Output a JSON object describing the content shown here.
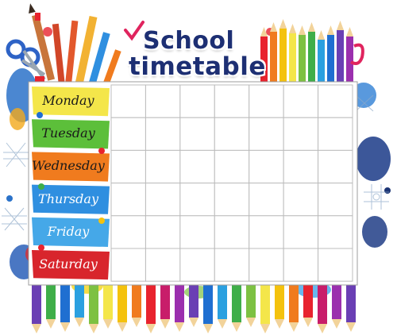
{
  "title": {
    "line1": "School",
    "line2": "timetable"
  },
  "days": [
    {
      "label": "Monday",
      "color": "#f4e64a",
      "text": "dark"
    },
    {
      "label": "Tuesday",
      "color": "#5cbf3a",
      "text": "dark"
    },
    {
      "label": "Wednesday",
      "color": "#f07b1e",
      "text": "dark"
    },
    {
      "label": "Thursday",
      "color": "#2f8fe0",
      "text": "light"
    },
    {
      "label": "Friday",
      "color": "#45a8e8",
      "text": "light"
    },
    {
      "label": "Saturday",
      "color": "#d8252c",
      "text": "light"
    }
  ],
  "grid": {
    "columns": 7,
    "rows": 6
  },
  "colors": {
    "title": "#1d2f73",
    "grid_line": "#bcbcbc",
    "checkmark": "#e0245e"
  }
}
